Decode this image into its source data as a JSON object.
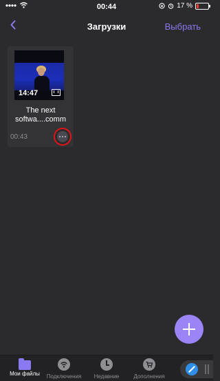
{
  "status_bar": {
    "time": "00:44",
    "battery": "17 %",
    "battery_level": 0.17
  },
  "nav": {
    "back_icon": "chevron-left-icon",
    "title": "Загрузки",
    "select_label": "Выбрать"
  },
  "files": [
    {
      "duration": "14:47",
      "title_line1": "The next",
      "title_line2": "softwa....comm",
      "time": "00:43",
      "more_icon": "ellipsis-icon"
    }
  ],
  "fab": {
    "icon": "plus-icon"
  },
  "tabs": [
    {
      "label": "Мои файлы",
      "icon": "folder-icon",
      "active": true
    },
    {
      "label": "Подключения",
      "icon": "wifi-icon",
      "active": false
    },
    {
      "label": "Недавние",
      "icon": "clock-icon",
      "active": false
    },
    {
      "label": "Дополнения",
      "icon": "cart-icon",
      "active": false
    }
  ],
  "browser": {
    "icon": "compass-icon"
  },
  "colors": {
    "accent": "#8b79f2",
    "background": "#2b2b2d",
    "highlight": "#e0151c",
    "fab": "#9b84f5"
  }
}
